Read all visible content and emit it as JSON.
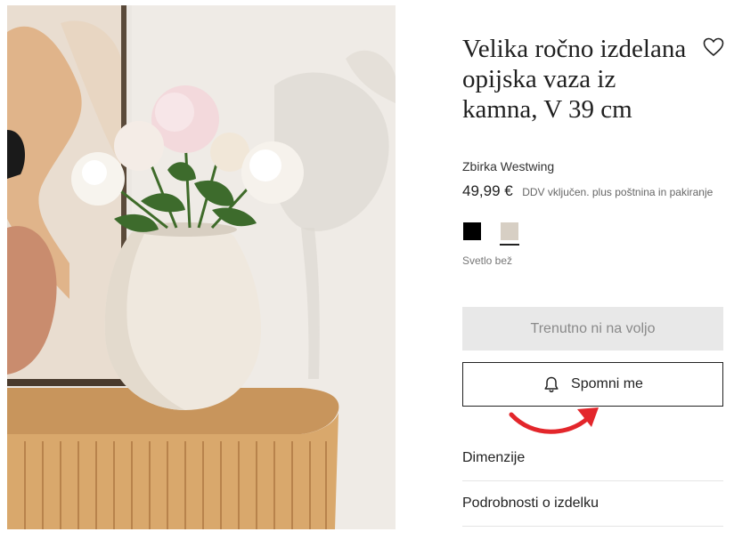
{
  "product": {
    "title": "Velika ročno izdelana opijska vaza iz kamna, V 39 cm",
    "brand": "Zbirka Westwing",
    "price": "49,99 €",
    "vat_note": "DDV vključen. plus poštnina in pakiranje",
    "selected_color": "Svetlo bež"
  },
  "swatches": [
    {
      "name": "black",
      "color": "#000000"
    },
    {
      "name": "light-beige",
      "color": "#d7cfc4",
      "selected": true
    }
  ],
  "buttons": {
    "unavailable_label": "Trenutno ni na voljo",
    "notify_label": "Spomni me"
  },
  "accordion": [
    {
      "label": "Dimenzije"
    },
    {
      "label": "Podrobnosti o izdelku"
    }
  ],
  "icons": {
    "wishlist": "heart-icon",
    "notify": "bell-icon",
    "annotation": "red-arrow"
  },
  "colors": {
    "accent_arrow": "#e3262b",
    "disabled_bg": "#e8e8e8"
  }
}
